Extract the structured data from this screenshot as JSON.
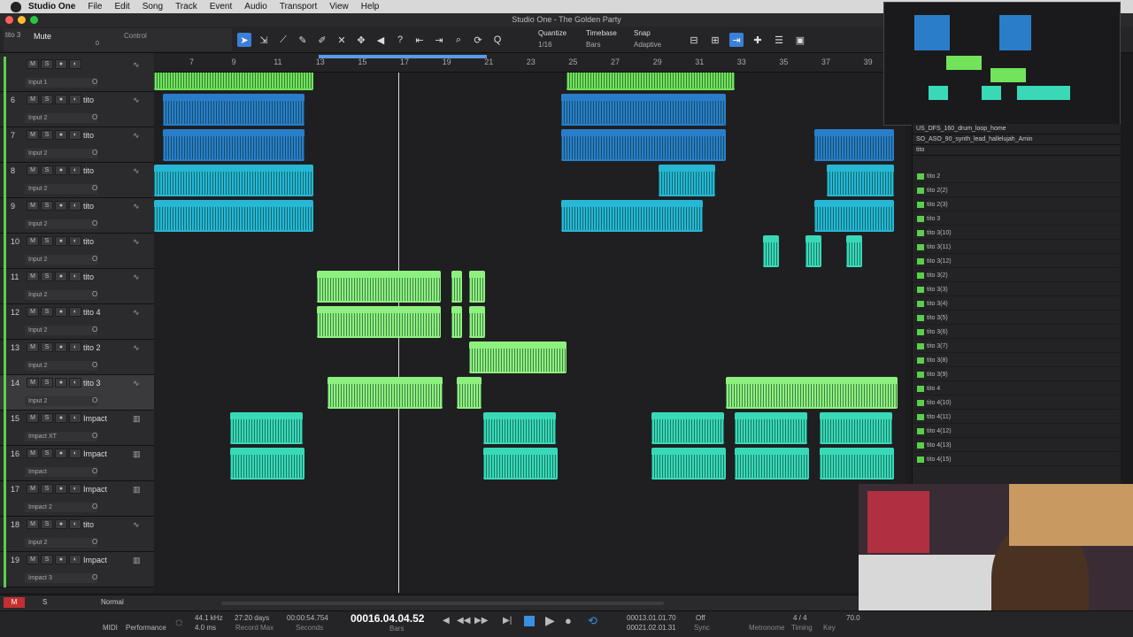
{
  "menubar": {
    "app": "Studio One",
    "items": [
      "File",
      "Edit",
      "Song",
      "Track",
      "Event",
      "Audio",
      "Transport",
      "View",
      "Help"
    ]
  },
  "window": {
    "title": "Studio One - The Golden Party"
  },
  "inspector": {
    "mute_label": "Mute",
    "control_label": "Control",
    "track_sel": "tito 3",
    "zero": "0"
  },
  "quantize": {
    "label": "Quantize",
    "value": "1/16"
  },
  "timebase": {
    "label": "Timebase",
    "value": "Bars"
  },
  "snap": {
    "label": "Snap",
    "value": "Adaptive"
  },
  "ruler": {
    "ticks": [
      "7",
      "9",
      "11",
      "13",
      "15",
      "17",
      "19",
      "21",
      "23",
      "25",
      "27",
      "29",
      "31",
      "33",
      "35",
      "37",
      "39"
    ]
  },
  "tracks": [
    {
      "num": "",
      "name": "",
      "input": "Input 1",
      "type": "audio"
    },
    {
      "num": "6",
      "name": "tito",
      "input": "Input 2",
      "type": "audio"
    },
    {
      "num": "7",
      "name": "tito",
      "input": "Input 2",
      "type": "audio"
    },
    {
      "num": "8",
      "name": "tito",
      "input": "Input 2",
      "type": "audio"
    },
    {
      "num": "9",
      "name": "tito",
      "input": "Input 2",
      "type": "audio"
    },
    {
      "num": "10",
      "name": "tito",
      "input": "Input 2",
      "type": "audio"
    },
    {
      "num": "11",
      "name": "tito",
      "input": "Input 2",
      "type": "audio"
    },
    {
      "num": "12",
      "name": "tito 4",
      "input": "Input 2",
      "type": "audio"
    },
    {
      "num": "13",
      "name": "tito 2",
      "input": "Input 2",
      "type": "audio"
    },
    {
      "num": "14",
      "name": "tito 3",
      "input": "Input 2",
      "type": "audio",
      "selected": true
    },
    {
      "num": "15",
      "name": "Impact",
      "input": "Impact XT",
      "type": "inst"
    },
    {
      "num": "16",
      "name": "Impact",
      "input": "Impact",
      "type": "inst"
    },
    {
      "num": "17",
      "name": "Impact",
      "input": "Impact 2",
      "type": "inst"
    },
    {
      "num": "18",
      "name": "tito",
      "input": "Input 2",
      "type": "audio"
    },
    {
      "num": "19",
      "name": "Impact",
      "input": "Impact 3",
      "type": "inst"
    }
  ],
  "browser": {
    "header1": "US_DFS_160_drum_loop_home",
    "header2": "SO_ASO_90_synth_lead_hallelujah_Amin",
    "header3": "tito",
    "items": [
      "tito 2",
      "tito 2(2)",
      "tito 2(3)",
      "tito 3",
      "tito 3(10)",
      "tito 3(11)",
      "tito 3(12)",
      "tito 3(2)",
      "tito 3(3)",
      "tito 3(4)",
      "tito 3(5)",
      "tito 3(6)",
      "tito 3(7)",
      "tito 3(8)",
      "tito 3(9)",
      "tito 4",
      "tito 4(10)",
      "tito 4(11)",
      "tito 4(12)",
      "tito 4(13)",
      "tito 4(15)"
    ]
  },
  "status": {
    "m": "M",
    "s": "S",
    "mode": "Normal"
  },
  "transport": {
    "sample_rate": "44.1 kHz",
    "latency": "4.0 ms",
    "midi": "MIDI",
    "performance": "Performance",
    "record_max": "27:20 days",
    "record_max_lbl": "Record Max",
    "seconds": "00:00:54.754",
    "seconds_lbl": "Seconds",
    "bars": "00016.04.04.52",
    "bars_lbl": "Bars",
    "loop_l": "00013.01.01.70",
    "loop_r": "00021.02.01.31",
    "sync": "Off",
    "sync_lbl": "Sync",
    "metronome": "Metronome",
    "timing": "4 / 4",
    "timing_lbl": "Timing",
    "key": "Key",
    "tempo": "70.0",
    "tempo_lbl": "Tempo"
  },
  "colors": {
    "green": "#72e35a",
    "teal": "#39d9b8",
    "blue": "#2a7ec9",
    "cyan": "#26b7d4",
    "lightgreen": "#8ef07e"
  }
}
